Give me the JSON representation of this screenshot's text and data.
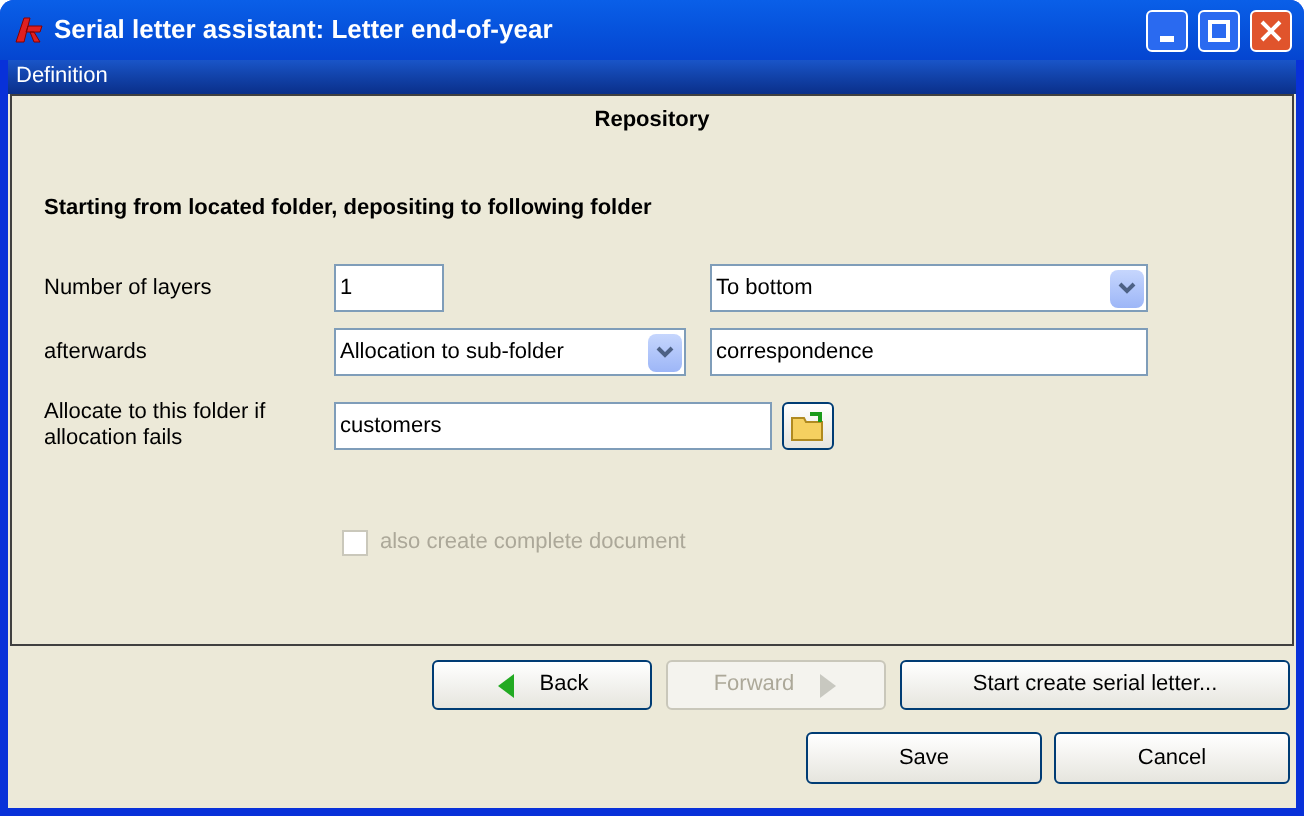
{
  "window": {
    "title": "Serial letter assistant: Letter end-of-year"
  },
  "menu": [
    "Definition"
  ],
  "section_title": "Repository",
  "heading": "Starting from located folder, depositing to following folder",
  "layers": {
    "label": "Number of layers",
    "value": "1",
    "direction": "To bottom"
  },
  "afterwards": {
    "label": "afterwards",
    "mode": "Allocation to sub-folder",
    "value": "correspondence"
  },
  "fallback": {
    "label": "Allocate to this folder if allocation fails",
    "value": "customers"
  },
  "complete_document": {
    "label": "also create complete document",
    "checked": false,
    "disabled": true
  },
  "nav_buttons": [
    {
      "kind": "back",
      "label": "Back",
      "disabled": false
    },
    {
      "kind": "forward",
      "label": "Forward",
      "disabled": true
    },
    {
      "kind": "start",
      "label": "Start create serial letter...",
      "disabled": false
    }
  ],
  "buttons": [
    "Save",
    "Cancel"
  ]
}
